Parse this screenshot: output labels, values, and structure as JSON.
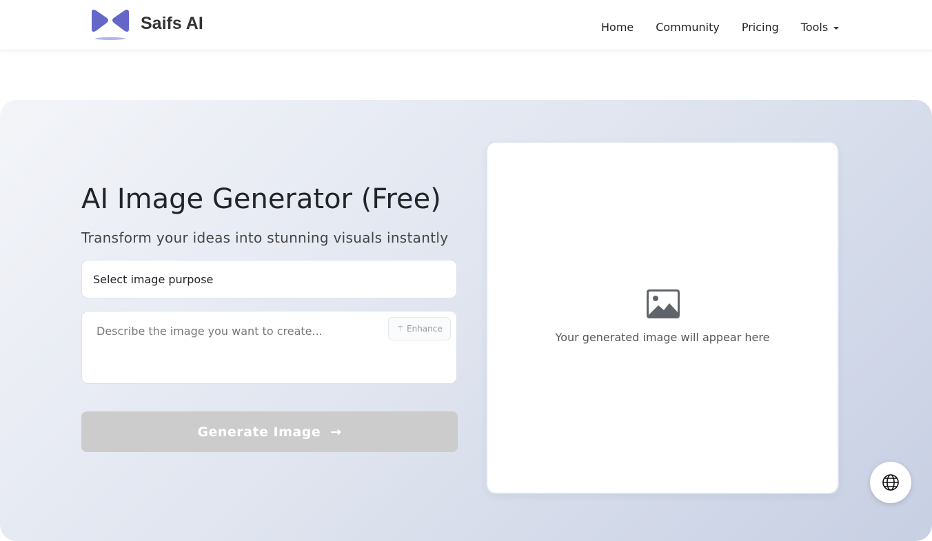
{
  "brand": {
    "name": "Saifs AI",
    "color": "#6466c8"
  },
  "nav": {
    "home": "Home",
    "community": "Community",
    "pricing": "Pricing",
    "tools": "Tools"
  },
  "hero": {
    "title": "AI Image Generator (Free)",
    "subtitle": "Transform your ideas into stunning visuals instantly",
    "purpose_select": "Select image purpose",
    "prompt_placeholder": "Describe the image you want to create...",
    "enhance_label": "Enhance",
    "generate_label": "Generate Image",
    "preview_caption": "Your generated image will appear here"
  }
}
